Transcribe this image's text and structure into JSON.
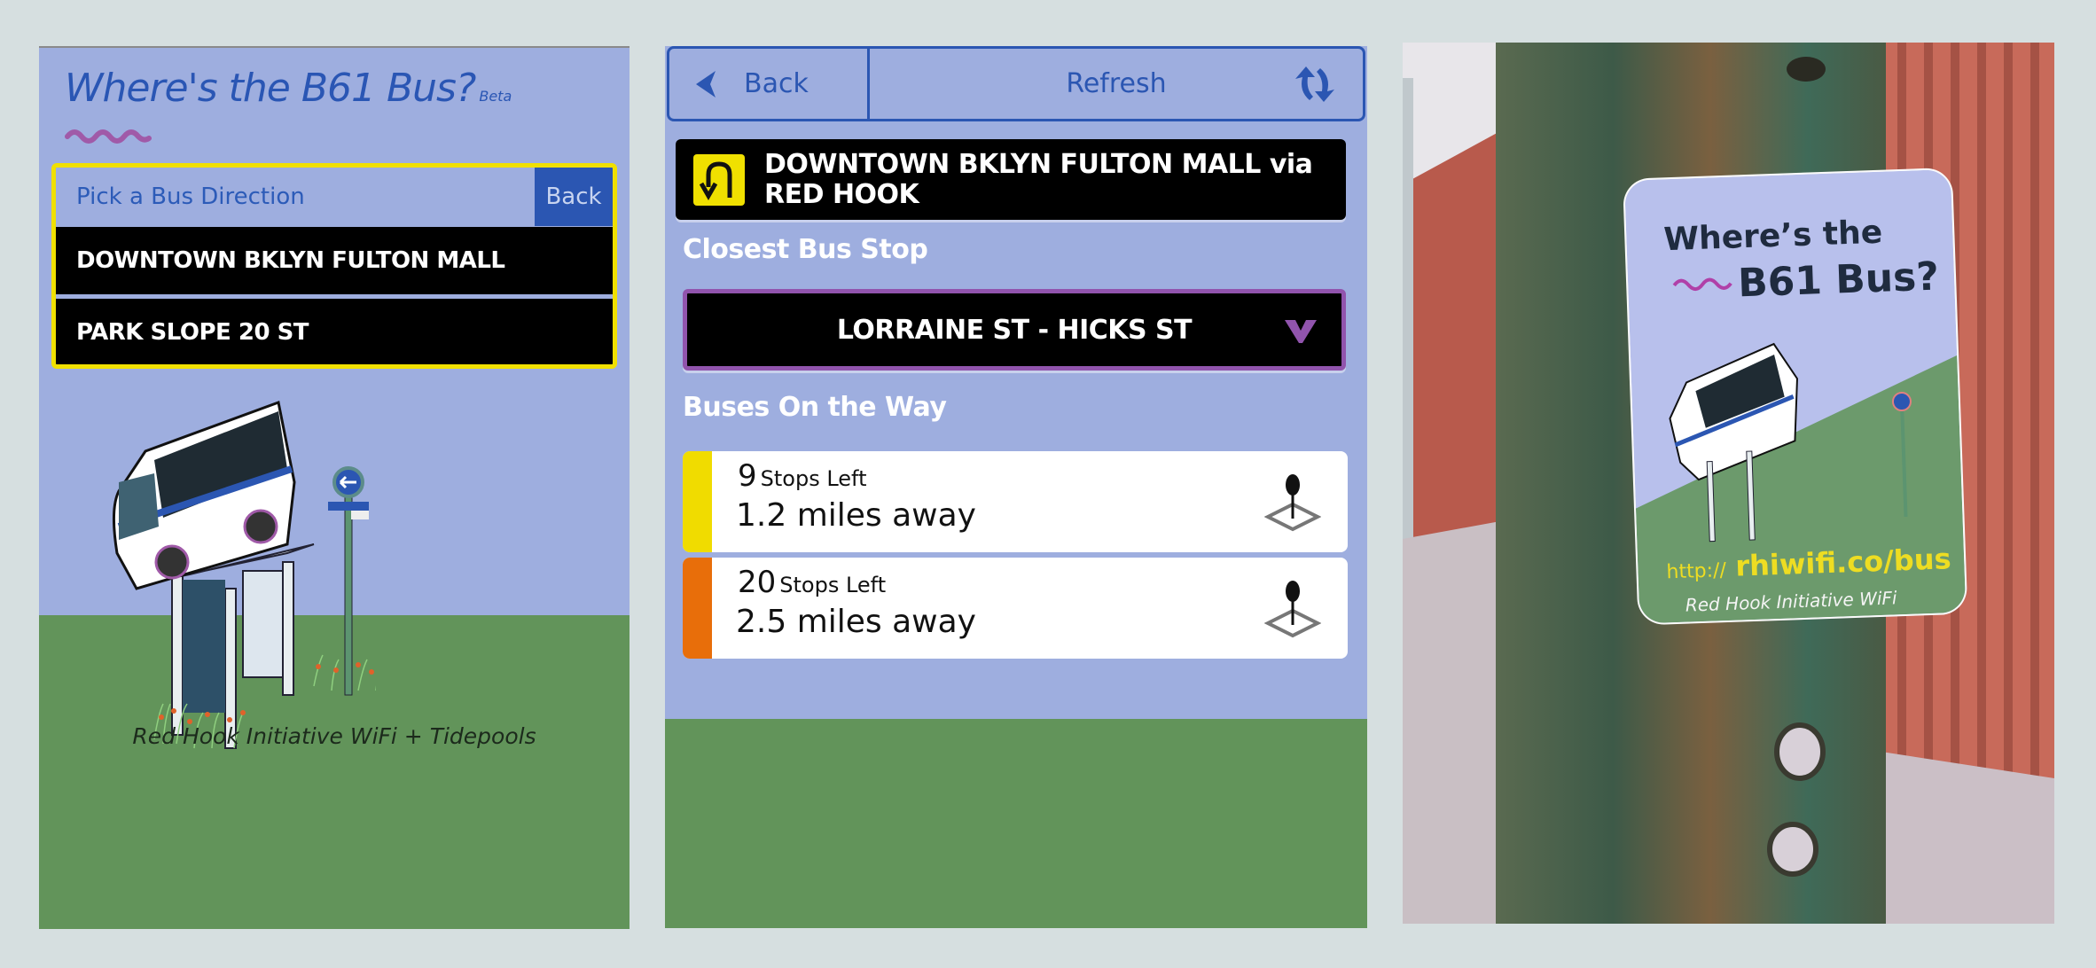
{
  "left_screen": {
    "title": "Where's the B61 Bus?",
    "title_badge": "Beta",
    "direction_picker": {
      "heading": "Pick a Bus Direction",
      "back_label": "Back",
      "options": [
        {
          "label": "DOWNTOWN BKLYN FULTON MALL"
        },
        {
          "label": "PARK SLOPE 20 ST"
        }
      ]
    },
    "illustration": "bus-on-shelter-illustration",
    "footer": "Red Hook Initiative WiFi + Tidepools"
  },
  "middle_screen": {
    "toolbar": {
      "back_label": "Back",
      "back_icon": "chevron-left-icon",
      "refresh_label": "Refresh",
      "refresh_icon": "refresh-icon"
    },
    "route": {
      "icon": "u-turn-icon",
      "label": "DOWNTOWN BKLYN FULTON MALL via RED HOOK"
    },
    "closest_stop_label": "Closest Bus Stop",
    "closest_stop_value": "LORRAINE ST - HICKS ST",
    "buses_label": "Buses On the Way",
    "buses": [
      {
        "stops": "9",
        "stops_label": "Stops Left",
        "distance": "1.2 miles away",
        "color": "#f0dc00"
      },
      {
        "stops": "20",
        "stops_label": "Stops Left",
        "distance": "2.5 miles away",
        "color": "#e86e0a"
      }
    ]
  },
  "photo": {
    "sticker": {
      "title_line1": "Where’s the",
      "title_line2": "B61 Bus?",
      "url_prefix": "http://",
      "url_main": "rhiwifi.co/bus",
      "credit": "Red Hook Initiative WiFi"
    }
  },
  "colors": {
    "sky": "#9eaedf",
    "ground": "#62945a",
    "brand_blue": "#2b56b2",
    "highlight_yellow": "#f0e000",
    "dropdown_purple": "#9154ad",
    "squiggle": "#a05aa8",
    "background": "#d6dfe0"
  }
}
